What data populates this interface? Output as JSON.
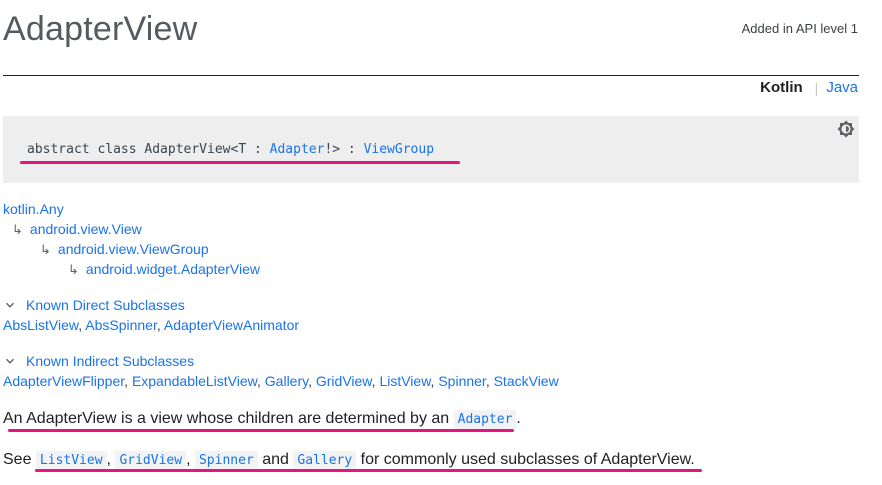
{
  "header": {
    "title": "AdapterView",
    "api_level": "Added in API level 1"
  },
  "language_switch": {
    "active": "Kotlin",
    "separator": "|",
    "other": "Java"
  },
  "declaration": {
    "prefix": "abstract class AdapterView<T : ",
    "adapter": "Adapter",
    "middle": "!> : ",
    "parent": "ViewGroup",
    "theme_icon": "brightness-icon"
  },
  "hierarchy": [
    {
      "arrow": "",
      "label": "kotlin.Any"
    },
    {
      "arrow": "↳",
      "label": "android.view.View"
    },
    {
      "arrow": "↳",
      "label": "android.view.ViewGroup"
    },
    {
      "arrow": "↳",
      "label": "android.widget.AdapterView"
    }
  ],
  "direct_subclasses": {
    "toggle_label": "Known Direct Subclasses",
    "items": [
      "AbsListView",
      "AbsSpinner",
      "AdapterViewAnimator"
    ]
  },
  "indirect_subclasses": {
    "toggle_label": "Known Indirect Subclasses",
    "items": [
      "AdapterViewFlipper",
      "ExpandableListView",
      "Gallery",
      "GridView",
      "ListView",
      "Spinner",
      "StackView"
    ]
  },
  "description": {
    "line1_text": "An AdapterView is a view whose children are determined by an ",
    "line1_code": "Adapter",
    "line1_end": ".",
    "line2_see": "See ",
    "line2_codes": [
      "ListView",
      "GridView",
      "Spinner",
      "Gallery"
    ],
    "line2_comma": ",",
    "line2_and": "and",
    "line2_end": "for commonly used subclasses of AdapterView."
  },
  "colors": {
    "link": "#1a73e8",
    "annotation": "#e8137f",
    "code_bg": "#eeeeee"
  }
}
